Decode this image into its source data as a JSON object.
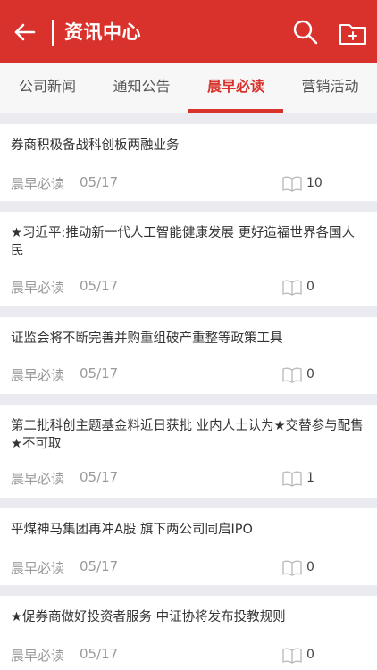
{
  "header": {
    "title": "资讯中心",
    "back_icon": "arrow-left-icon",
    "search_icon": "search-icon",
    "folder_icon": "folder-add-icon"
  },
  "tabs": [
    {
      "label": "公司新闻"
    },
    {
      "label": "通知公告"
    },
    {
      "label": "晨早必读",
      "active": true
    },
    {
      "label": "营销活动"
    }
  ],
  "articles": [
    {
      "title": "券商积极备战科创板两融业务",
      "source": "晨早必读",
      "date": "05/17",
      "count": "10"
    },
    {
      "title": "★习近平:推动新一代人工智能健康发展 更好造福世界各国人民",
      "source": "晨早必读",
      "date": "05/17",
      "count": "0"
    },
    {
      "title": "证监会将不断完善并购重组破产重整等政策工具",
      "source": "晨早必读",
      "date": "05/17",
      "count": "0"
    },
    {
      "title": "第二批科创主题基金料近日获批 业内人士认为★交替参与配售★不可取",
      "source": "晨早必读",
      "date": "05/17",
      "count": "1"
    },
    {
      "title": "平煤神马集团再冲A股 旗下两公司同启IPO",
      "source": "晨早必读",
      "date": "05/17",
      "count": "0"
    },
    {
      "title": "★促券商做好投资者服务 中证协将发布投教规则",
      "source": "晨早必读",
      "date": "05/17",
      "count": "0"
    }
  ],
  "colors": {
    "accent": "#d9312b",
    "background": "#eceaf1"
  }
}
